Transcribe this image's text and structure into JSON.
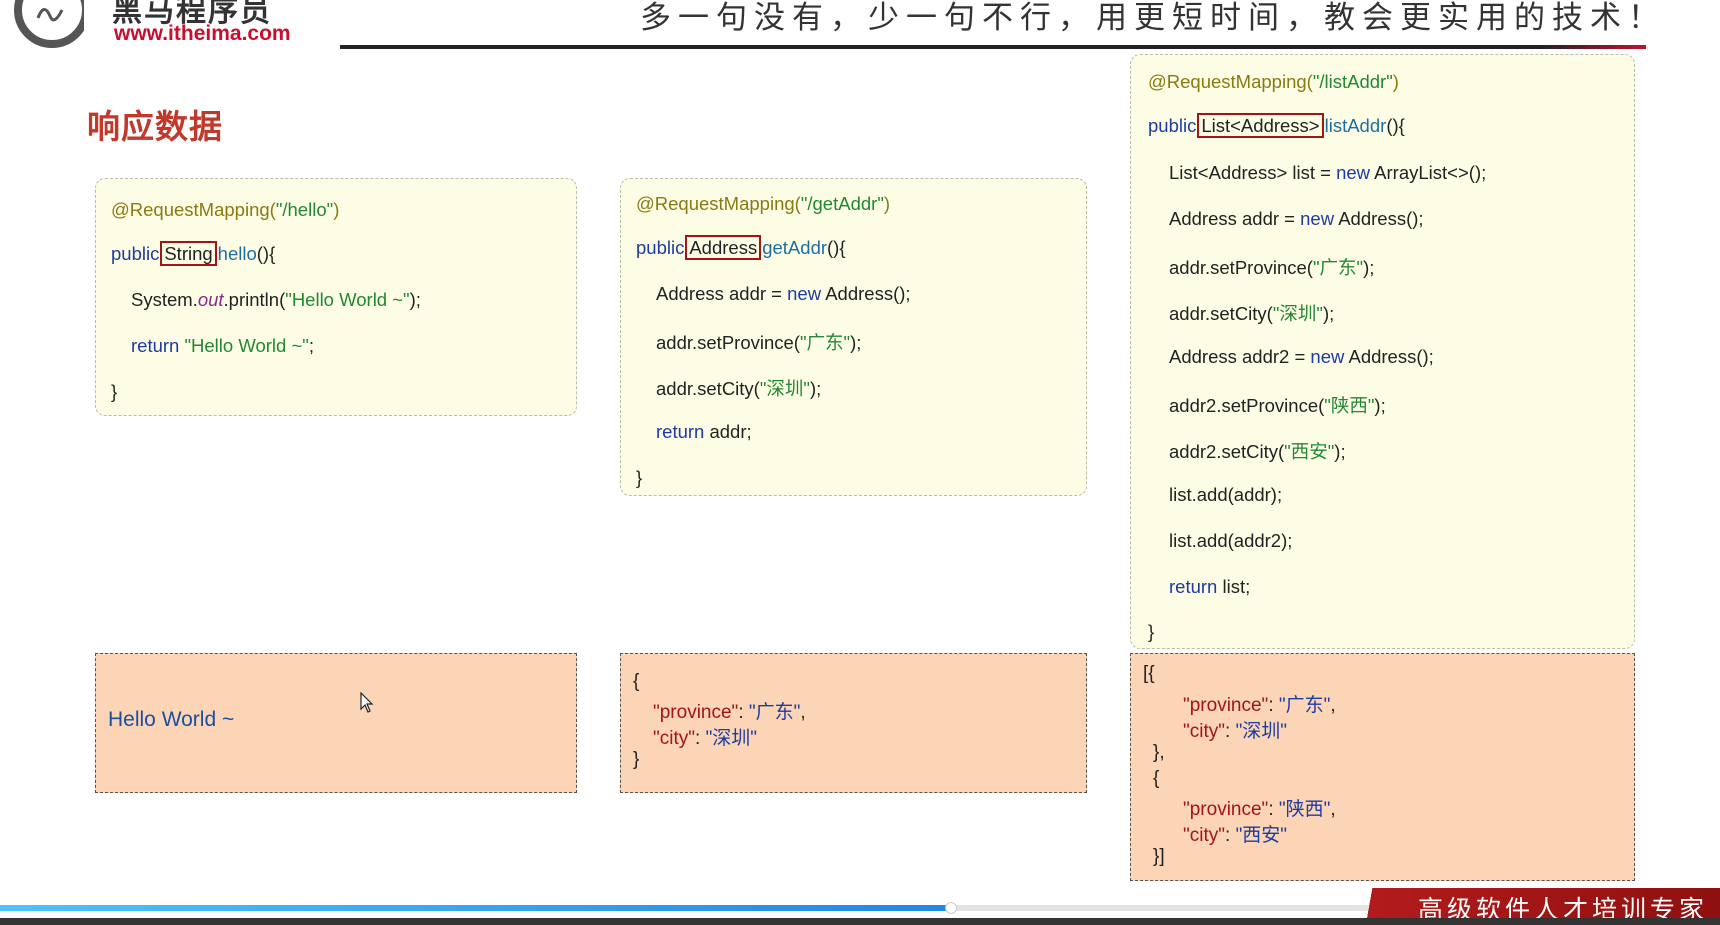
{
  "header": {
    "brand_name": "黑马程序员",
    "brand_url": "www.itheima.com",
    "slogan": "多一句没有，少一句不行，用更短时间，教会更实用的技术！"
  },
  "slide": {
    "title": "响应数据"
  },
  "box1": {
    "annotation": "@RequestMapping(",
    "path": "\"/hello\"",
    "close": ")",
    "kw_public": "public",
    "return_type": "String",
    "method": "hello",
    "method_tail": "(){",
    "println_pre": "System.",
    "println_out": "out",
    "println_call": ".println(",
    "println_arg": "\"Hello World ~\"",
    "println_end": ");",
    "kw_return": "return",
    "return_val": "\"Hello World ~\"",
    "return_end": ";",
    "brace": "}"
  },
  "box2": {
    "annotation": "@RequestMapping(",
    "path": "\"/getAddr\"",
    "close": ")",
    "kw_public": "public",
    "return_type": "Address",
    "method": "getAddr",
    "method_tail": "(){",
    "l1a": "Address addr = ",
    "kw_new": "new",
    "l1b": " Address();",
    "l2a": "addr.setProvince(",
    "l2s": "\"广东\"",
    "l2b": ");",
    "l3a": "addr.setCity(",
    "l3s": "\"深圳\"",
    "l3b": ");",
    "kw_return": "return",
    "l4b": " addr;",
    "brace": "}"
  },
  "box3": {
    "annotation": "@RequestMapping(",
    "path": "\"/listAddr\"",
    "close": ")",
    "kw_public": "public",
    "return_type": "List<Address>",
    "method": "listAddr",
    "method_tail": "(){",
    "l1a": "List<Address> list = ",
    "kw_new": "new",
    "l1b": " ArrayList<>();",
    "l2a": "Address addr = ",
    "l2b": " Address();",
    "l3a": "addr.setProvince(",
    "l3s": "\"广东\"",
    "l3b": ");",
    "l4a": "addr.setCity(",
    "l4s": "\"深圳\"",
    "l4b": ");",
    "l5a": "Address addr2 = ",
    "l5b": " Address();",
    "l6a": "addr2.setProvince(",
    "l6s": "\"陕西\"",
    "l6b": ");",
    "l7a": "addr2.setCity(",
    "l7s": "\"西安\"",
    "l7b": ");",
    "l8": "list.add(addr);",
    "l9": "list.add(addr2);",
    "kw_return": "return",
    "l10b": " list;",
    "brace": "}"
  },
  "out1": {
    "text": "Hello World ~"
  },
  "out2": {
    "open": "{",
    "k_province": "\"province\"",
    "v_province": "\"广东\"",
    "k_city": "\"city\"",
    "v_city": "\"深圳\"",
    "close": "}",
    "colon": ": ",
    "comma": ","
  },
  "out3": {
    "open": "[{",
    "k_province": "\"province\"",
    "v_province1": "\"广东\"",
    "k_city": "\"city\"",
    "v_city1": "\"深圳\"",
    "mid_close": "},",
    "mid_open": "{",
    "v_province2": "\"陕西\"",
    "v_city2": "\"西安\"",
    "close": "}]",
    "colon": ": ",
    "comma": ","
  },
  "footer": {
    "text": "高级软件人才培训专家"
  },
  "progress": {
    "fraction": 0.553
  }
}
